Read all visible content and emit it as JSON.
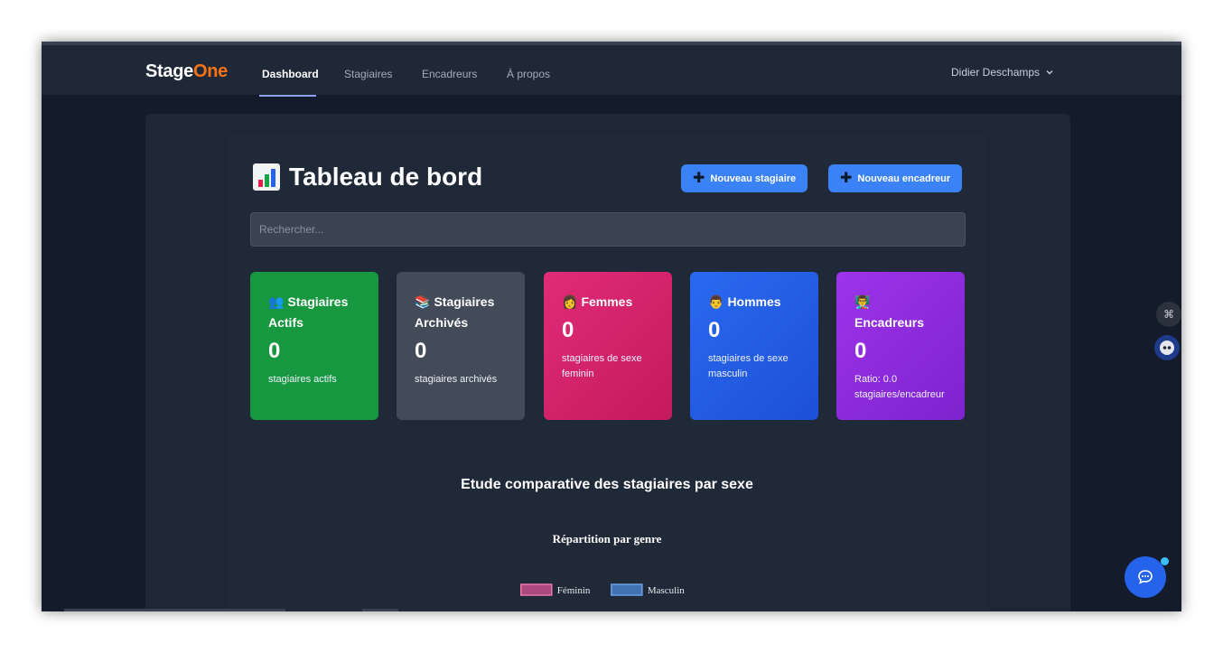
{
  "nav": {
    "brand_main": "Stage",
    "brand_accent": "One",
    "links": [
      "Dashboard",
      "Stagiaires",
      "Encadreurs",
      "À propos"
    ],
    "active": "Dashboard",
    "user": "Didier Deschamps"
  },
  "header": {
    "title": "Tableau de bord",
    "btn_new_intern": "Nouveau stagiaire",
    "btn_new_supervisor": "Nouveau encadreur"
  },
  "search": {
    "placeholder": "Rechercher..."
  },
  "cards": [
    {
      "title": "Stagiaires Actifs",
      "icon": "👥",
      "value": "0",
      "desc": "stagiaires actifs",
      "color": "#16a34a"
    },
    {
      "title": "Stagiaires Archivés",
      "icon": "📚",
      "value": "0",
      "desc": "stagiaires archivés",
      "color": "#4b5563"
    },
    {
      "title": "Femmes",
      "icon": "👩",
      "value": "0",
      "desc": "stagiaires de sexe feminin",
      "color": "#db2777"
    },
    {
      "title": "Hommes",
      "icon": "👨",
      "value": "0",
      "desc": "stagiaires de sexe masculin",
      "color": "#2563eb"
    },
    {
      "title": "Encadreurs",
      "icon": "👨‍🏫",
      "value": "0",
      "desc": "Ratio: 0.0 stagiaires/encadreur",
      "color": "#9333ea"
    }
  ],
  "chart_section": {
    "heading": "Etude comparative des stagiaires par sexe"
  },
  "chart_data": {
    "type": "pie",
    "title": "Répartition par genre",
    "categories": [
      "Féminin",
      "Masculin"
    ],
    "values": [
      0,
      0
    ],
    "colors": [
      "#c44d8b",
      "#4a7fc9"
    ],
    "legend": "top"
  }
}
